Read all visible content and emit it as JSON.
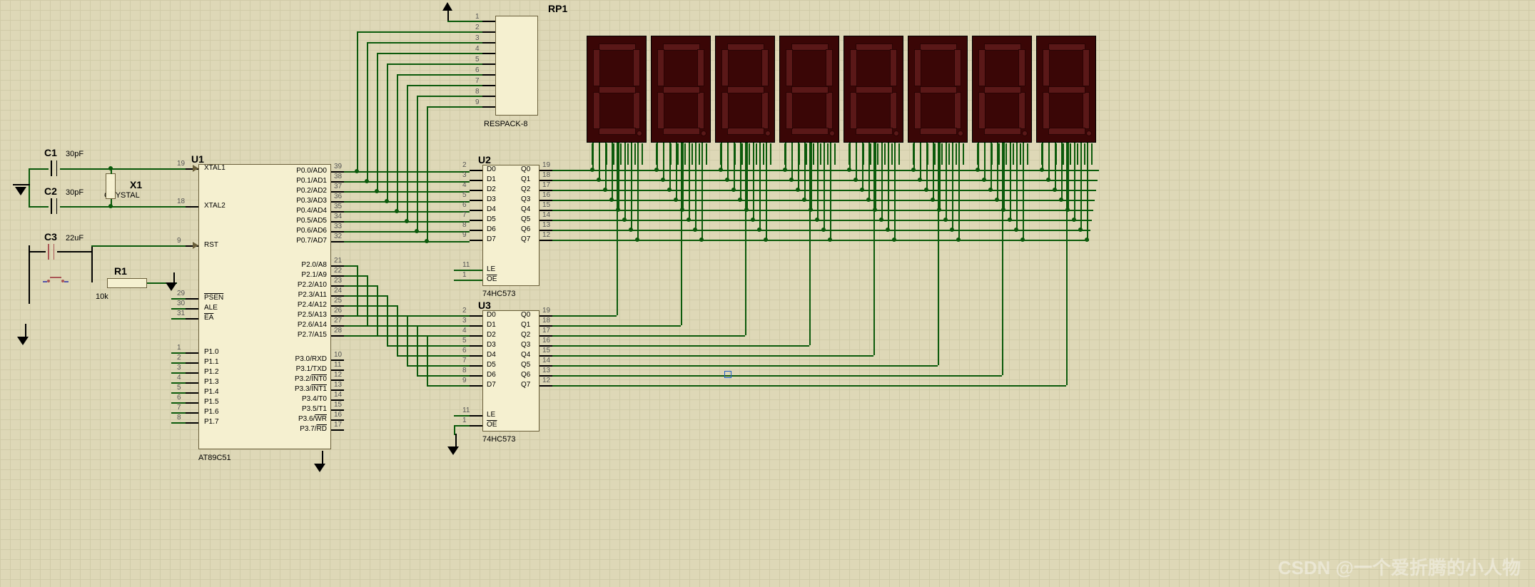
{
  "components": {
    "C1": {
      "ref": "C1",
      "value": "30pF"
    },
    "C2": {
      "ref": "C2",
      "value": "30pF"
    },
    "C3": {
      "ref": "C3",
      "value": "22uF"
    },
    "R1": {
      "ref": "R1",
      "value": "10k"
    },
    "X1": {
      "ref": "X1",
      "value": "CRYSTAL"
    },
    "RP1": {
      "ref": "RP1",
      "value": "RESPACK-8"
    },
    "U1": {
      "ref": "U1",
      "value": "AT89C51"
    },
    "U2": {
      "ref": "U2",
      "value": "74HC573"
    },
    "U3": {
      "ref": "U3",
      "value": "74HC573"
    }
  },
  "U1_pins": {
    "left": [
      {
        "num": "19",
        "name": "XTAL1"
      },
      {
        "num": "18",
        "name": "XTAL2"
      },
      {
        "num": "9",
        "name": "RST"
      },
      {
        "num": "29",
        "name": "PSEN",
        "over": true
      },
      {
        "num": "30",
        "name": "ALE"
      },
      {
        "num": "31",
        "name": "EA",
        "over": true
      },
      {
        "num": "1",
        "name": "P1.0"
      },
      {
        "num": "2",
        "name": "P1.1"
      },
      {
        "num": "3",
        "name": "P1.2"
      },
      {
        "num": "4",
        "name": "P1.3"
      },
      {
        "num": "5",
        "name": "P1.4"
      },
      {
        "num": "6",
        "name": "P1.5"
      },
      {
        "num": "7",
        "name": "P1.6"
      },
      {
        "num": "8",
        "name": "P1.7"
      }
    ],
    "right": [
      {
        "num": "39",
        "name": "P0.0/AD0"
      },
      {
        "num": "38",
        "name": "P0.1/AD1"
      },
      {
        "num": "37",
        "name": "P0.2/AD2"
      },
      {
        "num": "36",
        "name": "P0.3/AD3"
      },
      {
        "num": "35",
        "name": "P0.4/AD4"
      },
      {
        "num": "34",
        "name": "P0.5/AD5"
      },
      {
        "num": "33",
        "name": "P0.6/AD6"
      },
      {
        "num": "32",
        "name": "P0.7/AD7"
      },
      {
        "num": "21",
        "name": "P2.0/A8"
      },
      {
        "num": "22",
        "name": "P2.1/A9"
      },
      {
        "num": "23",
        "name": "P2.2/A10"
      },
      {
        "num": "24",
        "name": "P2.3/A11"
      },
      {
        "num": "25",
        "name": "P2.4/A12"
      },
      {
        "num": "26",
        "name": "P2.5/A13"
      },
      {
        "num": "27",
        "name": "P2.6/A14"
      },
      {
        "num": "28",
        "name": "P2.7/A15"
      },
      {
        "num": "10",
        "name": "P3.0/RXD"
      },
      {
        "num": "11",
        "name": "P3.1/TXD"
      },
      {
        "num": "12",
        "name": "P3.2/INT0",
        "over2": true
      },
      {
        "num": "13",
        "name": "P3.3/INT1",
        "over2": true
      },
      {
        "num": "14",
        "name": "P3.4/T0"
      },
      {
        "num": "15",
        "name": "P3.5/T1"
      },
      {
        "num": "16",
        "name": "P3.6/WR",
        "over2": true
      },
      {
        "num": "17",
        "name": "P3.7/RD",
        "over2": true
      }
    ]
  },
  "latch_pins": {
    "left": [
      {
        "num": "2",
        "name": "D0"
      },
      {
        "num": "3",
        "name": "D1"
      },
      {
        "num": "4",
        "name": "D2"
      },
      {
        "num": "5",
        "name": "D3"
      },
      {
        "num": "6",
        "name": "D4"
      },
      {
        "num": "7",
        "name": "D5"
      },
      {
        "num": "8",
        "name": "D6"
      },
      {
        "num": "9",
        "name": "D7"
      },
      {
        "num": "11",
        "name": "LE"
      },
      {
        "num": "1",
        "name": "OE",
        "over": true
      }
    ],
    "right": [
      {
        "num": "19",
        "name": "Q0"
      },
      {
        "num": "18",
        "name": "Q1"
      },
      {
        "num": "17",
        "name": "Q2"
      },
      {
        "num": "16",
        "name": "Q3"
      },
      {
        "num": "15",
        "name": "Q4"
      },
      {
        "num": "14",
        "name": "Q5"
      },
      {
        "num": "13",
        "name": "Q6"
      },
      {
        "num": "12",
        "name": "Q7"
      }
    ]
  },
  "RP1_pins": [
    "1",
    "2",
    "3",
    "4",
    "5",
    "6",
    "7",
    "8",
    "9"
  ],
  "watermark": "CSDN @一个爱折腾的小人物"
}
